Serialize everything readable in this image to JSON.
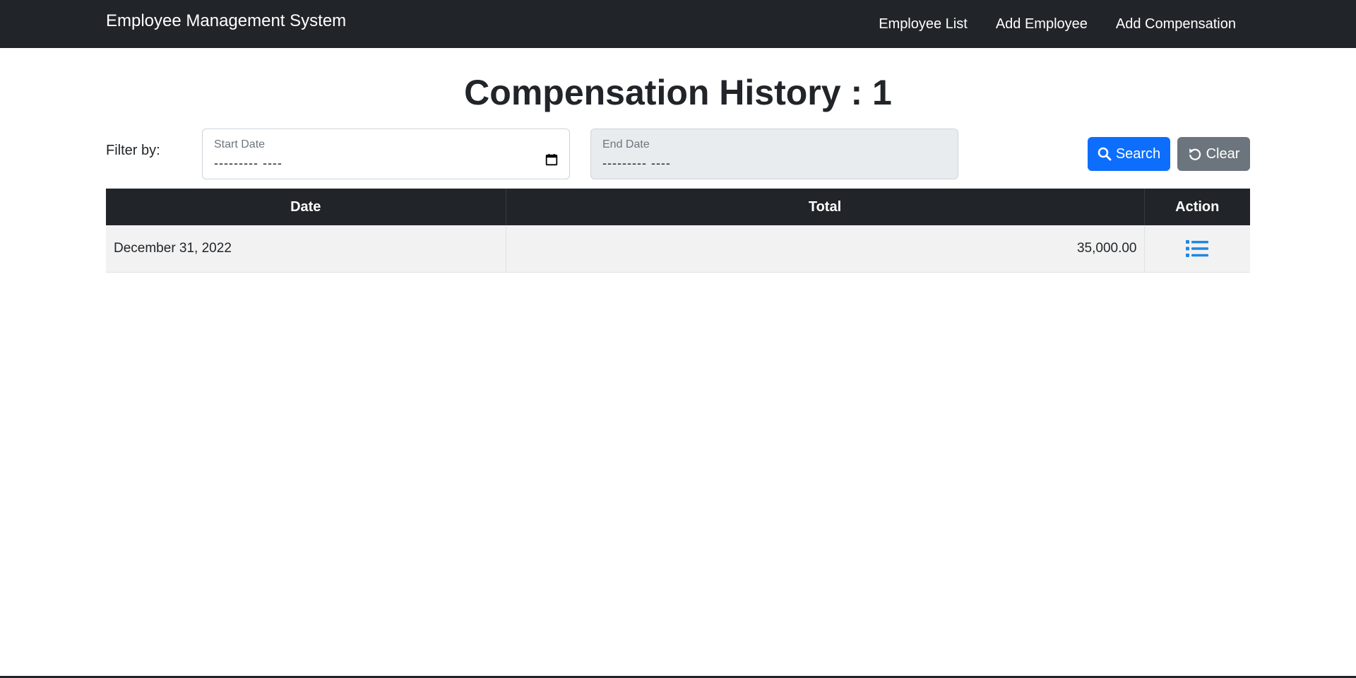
{
  "navbar": {
    "brand": "Employee Management System",
    "links": [
      "Employee List",
      "Add Employee",
      "Add Compensation"
    ]
  },
  "page": {
    "title": "Compensation History : 1"
  },
  "filter": {
    "label": "Filter by:",
    "start_date": {
      "label": "Start Date",
      "value": "--------- ----"
    },
    "end_date": {
      "label": "End Date",
      "value": "--------- ----",
      "disabled": true
    },
    "search_label": "Search",
    "clear_label": "Clear"
  },
  "table": {
    "headers": [
      "Date",
      "Total",
      "Action"
    ],
    "rows": [
      {
        "date": "December 31, 2022",
        "total": "35,000.00",
        "action_icon": "list-icon"
      }
    ]
  },
  "colors": {
    "navbar_bg": "#212529",
    "primary": "#0d6efd",
    "secondary": "#6c757d",
    "action_icon": "#1e88e5"
  }
}
